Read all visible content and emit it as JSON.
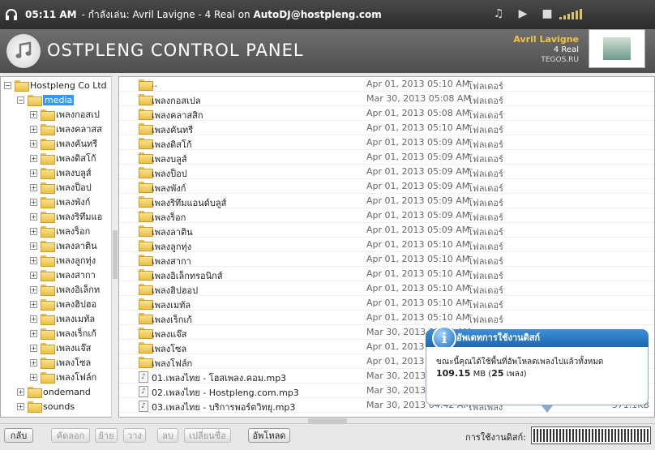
{
  "topbar": {
    "time": "05:11 AM",
    "now_playing_prefix": " - กำลังเล่น: ",
    "now_playing_track": "Avril Lavigne - 4 Real on ",
    "now_playing_server": "AutoDJ@hostpleng.com",
    "controls": [
      "music-note-icon",
      "play-icon",
      "stop-icon"
    ]
  },
  "header": {
    "panel_title": "OSTPLENG CONTROL PANEL",
    "artist": "Avril Lavigne",
    "title": "4 Real",
    "site": "TEGOS.RU"
  },
  "tree": {
    "root": "Hostpleng Co Ltd",
    "selected": "media",
    "children": [
      "เพลงกอสเป",
      "เพลงคลาสส",
      "เพลงคันทรี",
      "เพลงดิสโก้",
      "เพลงบลูส์",
      "เพลงป็อป",
      "เพลงพังก์",
      "เพลงริทึมแอ",
      "เพลงร็อก",
      "เพลงลาติน",
      "เพลงลูกทุ่ง",
      "เพลงสากา",
      "เพลงอิเล็กท",
      "เพลงฮิปฮอ",
      "เพลงเมทัล",
      "เพลงเร็กเก้",
      "เพลงแจ๊ส",
      "เพลงโซล",
      "เพลงโฟล์ก"
    ],
    "siblings": [
      "ondemand",
      "sounds"
    ]
  },
  "files": [
    {
      "name": "..",
      "date": "Apr 01, 2013 05:10 AM",
      "type": "โฟลเดอร์",
      "size": "",
      "kind": "folder"
    },
    {
      "name": "เพลงกอสเปล",
      "date": "Mar 30, 2013 05:08 AM",
      "type": "โฟลเดอร์",
      "size": "",
      "kind": "folder"
    },
    {
      "name": "เพลงคลาสสิก",
      "date": "Apr 01, 2013 05:08 AM",
      "type": "โฟลเดอร์",
      "size": "",
      "kind": "folder"
    },
    {
      "name": "เพลงคันทรี",
      "date": "Apr 01, 2013 05:10 AM",
      "type": "โฟลเดอร์",
      "size": "",
      "kind": "folder"
    },
    {
      "name": "เพลงดิสโก้",
      "date": "Apr 01, 2013 05:09 AM",
      "type": "โฟลเดอร์",
      "size": "",
      "kind": "folder"
    },
    {
      "name": "เพลงบลูส์",
      "date": "Apr 01, 2013 05:09 AM",
      "type": "โฟลเดอร์",
      "size": "",
      "kind": "folder"
    },
    {
      "name": "เพลงป็อป",
      "date": "Apr 01, 2013 05:09 AM",
      "type": "โฟลเดอร์",
      "size": "",
      "kind": "folder"
    },
    {
      "name": "เพลงพังก์",
      "date": "Apr 01, 2013 05:09 AM",
      "type": "โฟลเดอร์",
      "size": "",
      "kind": "folder"
    },
    {
      "name": "เพลงริทึมแอนด์บลูส์",
      "date": "Apr 01, 2013 05:09 AM",
      "type": "โฟลเดอร์",
      "size": "",
      "kind": "folder"
    },
    {
      "name": "เพลงร็อก",
      "date": "Apr 01, 2013 05:09 AM",
      "type": "โฟลเดอร์",
      "size": "",
      "kind": "folder"
    },
    {
      "name": "เพลงลาติน",
      "date": "Apr 01, 2013 05:09 AM",
      "type": "โฟลเดอร์",
      "size": "",
      "kind": "folder"
    },
    {
      "name": "เพลงลูกทุ่ง",
      "date": "Apr 01, 2013 05:10 AM",
      "type": "โฟลเดอร์",
      "size": "",
      "kind": "folder"
    },
    {
      "name": "เพลงสากา",
      "date": "Apr 01, 2013 05:10 AM",
      "type": "โฟลเดอร์",
      "size": "",
      "kind": "folder"
    },
    {
      "name": "เพลงอิเล็กทรอนิกส์",
      "date": "Apr 01, 2013 05:10 AM",
      "type": "โฟลเดอร์",
      "size": "",
      "kind": "folder"
    },
    {
      "name": "เพลงฮิปฮอป",
      "date": "Apr 01, 2013 05:10 AM",
      "type": "โฟลเดอร์",
      "size": "",
      "kind": "folder"
    },
    {
      "name": "เพลงเมทัล",
      "date": "Apr 01, 2013 05:10 AM",
      "type": "โฟลเดอร์",
      "size": "",
      "kind": "folder"
    },
    {
      "name": "เพลงเร็กเก้",
      "date": "Apr 01, 2013 05:10 AM",
      "type": "โฟลเดอร์",
      "size": "",
      "kind": "folder"
    },
    {
      "name": "เพลงแจ๊ส",
      "date": "Mar 30, 2013 05:08 AM",
      "type": "โฟลเดอร์",
      "size": "",
      "kind": "folder"
    },
    {
      "name": "เพลงโซล",
      "date": "Apr 01, 2013 05:10 AM",
      "type": "โฟลเดอร์",
      "size": "",
      "kind": "folder"
    },
    {
      "name": "เพลงโฟล์ก",
      "date": "Apr 01, 2013 05:10 AM",
      "type": "โฟลเดอร์",
      "size": "",
      "kind": "folder"
    },
    {
      "name": "01.เพลงไทย - โฮสเพลง.คอม.mp3",
      "date": "Mar 30, 2013 04:42 AM",
      "type": "",
      "size": "",
      "kind": "mp3"
    },
    {
      "name": "02.เพลงไทย - Hostpleng.com.mp3",
      "date": "Mar 30, 2013 04:42 AM",
      "type": "",
      "size": "",
      "kind": "mp3"
    },
    {
      "name": "03.เพลงไทย - บริการพอร์ตวิทยุ.mp3",
      "date": "Mar 30, 2013 04:42 AM",
      "type": "ไฟล์เพลง",
      "size": "371.1KB",
      "kind": "mp3"
    }
  ],
  "toolbar": {
    "back": "กลับ",
    "copy": "คัดลอก",
    "move": "ย้าย",
    "paste": "วาง",
    "delete": "ลบ",
    "rename": "เปลี่ยนชื่อ",
    "upload": "อัพโหลด",
    "usage_label": "การใช้งานดิสก์:"
  },
  "popup": {
    "title": "อัพเดทการใช้งานดิสก์",
    "line1": "ขณะนี้คุณได้ใช้พื้นที่อัพโหลดเพลงไปแล้วทั้งหมด",
    "size_value": "109.15",
    "size_unit": " MB (",
    "count": "25",
    "count_suffix": " เพลง)"
  }
}
